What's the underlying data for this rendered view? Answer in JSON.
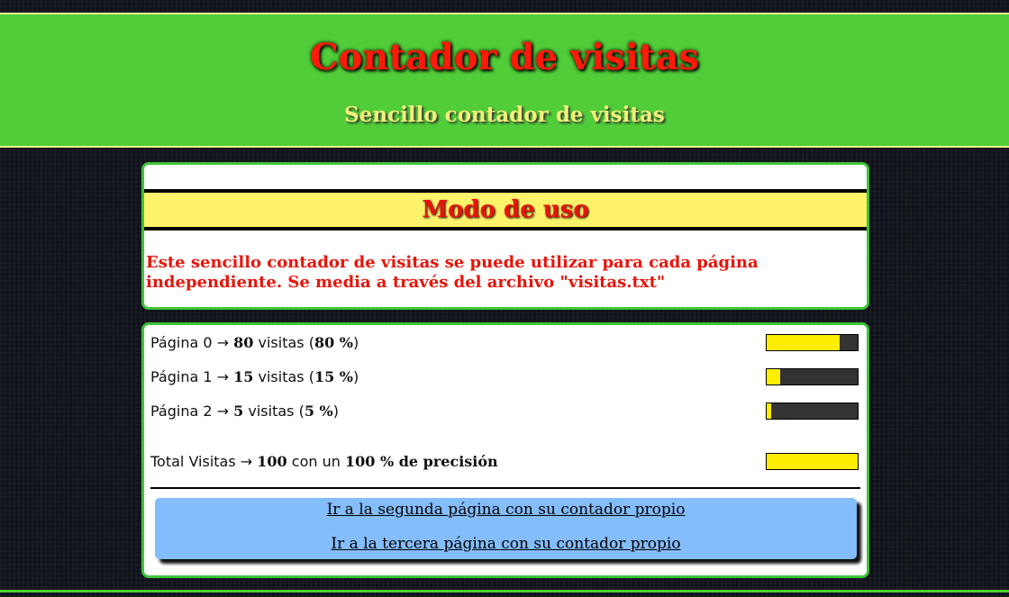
{
  "header": {
    "title": "Contador de visitas",
    "subtitle": "Sencillo contador de visitas"
  },
  "usage": {
    "title": "Modo de uso",
    "text": "Este sencillo contador de visitas se puede utilizar para cada página independiente. Se media a través del archivo \"visitas.txt\""
  },
  "counter": {
    "arrow": "→",
    "visits_word": "visitas",
    "rows": [
      {
        "label": "Página 0",
        "count": "80",
        "percent": "80 %",
        "fill": 0.8
      },
      {
        "label": "Página 1",
        "count": "15",
        "percent": "15 %",
        "fill": 0.15
      },
      {
        "label": "Página 2",
        "count": "5",
        "percent": "5 %",
        "fill": 0.05
      }
    ],
    "total": {
      "label": "Total Visitas",
      "count": "100",
      "connector": "con un",
      "precision": "100 % de precisión",
      "fill": 1.0
    }
  },
  "links": {
    "second": "Ir a la segunda página con su contador propio",
    "third": "Ir a la tercera página con su contador propio"
  },
  "colors": {
    "header_bg": "#50cd38",
    "title": "#ff1a0a",
    "subtitle": "#f4f07a",
    "bar_fill": "#ffee00",
    "bar_bg": "#333333",
    "links_bg": "#84bdfc"
  }
}
